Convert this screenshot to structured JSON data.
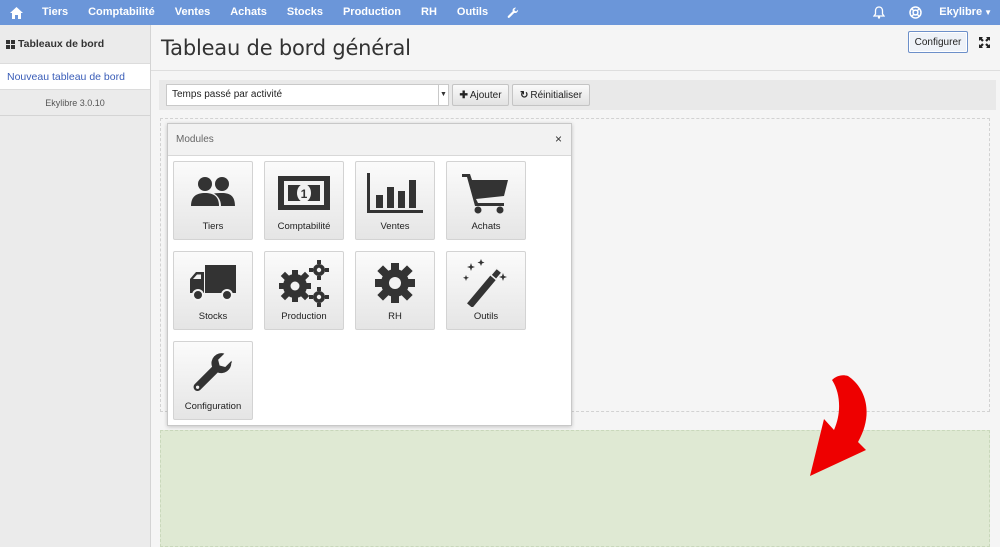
{
  "topnav": {
    "items": [
      "Tiers",
      "Comptabilité",
      "Ventes",
      "Achats",
      "Stocks",
      "Production",
      "RH",
      "Outils"
    ],
    "user": "Ekylibre",
    "icons": [
      "home-icon",
      "wrench-icon",
      "bell-icon",
      "help-icon"
    ],
    "bg_color": "#6b96d9"
  },
  "sidebar": {
    "heading": "Tableaux de bord",
    "link": "Nouveau tableau de bord",
    "version": "Ekylibre 3.0.10"
  },
  "main": {
    "title": "Tableau de bord général",
    "configure_label": "Configurer",
    "select_value": "Temps passé par activité",
    "add_label": "Ajouter",
    "reset_label": "Réinitialiser"
  },
  "modules": {
    "title": "Modules",
    "close": "×",
    "tiles": [
      {
        "label": "Tiers",
        "icon": "users-icon"
      },
      {
        "label": "Comptabilité",
        "icon": "banknote-icon"
      },
      {
        "label": "Ventes",
        "icon": "bar-chart-icon"
      },
      {
        "label": "Achats",
        "icon": "cart-icon"
      },
      {
        "label": "Stocks",
        "icon": "truck-icon"
      },
      {
        "label": "Production",
        "icon": "gears-icon"
      },
      {
        "label": "RH",
        "icon": "gear-icon"
      },
      {
        "label": "Outils",
        "icon": "magic-wand-icon"
      },
      {
        "label": "Configuration",
        "icon": "wrench-icon"
      }
    ]
  },
  "colors": {
    "accent": "#6b96d9",
    "link": "#3a5db8",
    "dropzone_fill": "#dfe9d3",
    "arrow": "#ee0000"
  }
}
